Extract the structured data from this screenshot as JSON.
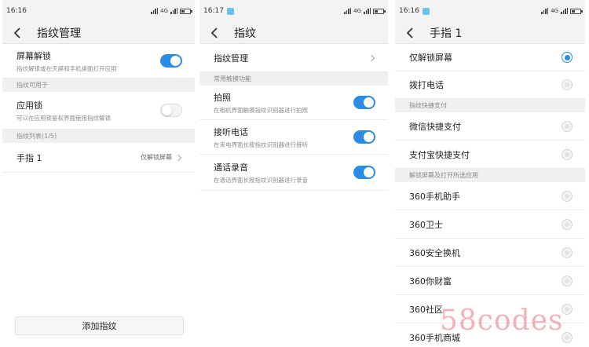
{
  "screen1": {
    "status_time": "16:16",
    "network": "4G",
    "title": "指纹管理",
    "unlock": {
      "label": "屏幕解锁",
      "sub": "指纹解锁或在灭屏和手机桌面打开应用",
      "on": true
    },
    "section_usable": "指纹可用于",
    "applock": {
      "label": "应用锁",
      "sub": "可以在应用锁鉴权界面使用指纹解锁",
      "on": false
    },
    "section_list": "指纹列表(1/5)",
    "finger": {
      "label": "手指 1",
      "value": "仅解锁屏幕"
    },
    "add_button": "添加指纹"
  },
  "screen2": {
    "status_time": "16:17",
    "network": "4G",
    "title": "指纹",
    "manage": "指纹管理",
    "section_touch": "常用触摸功能",
    "photo": {
      "label": "拍照",
      "sub": "在相机界面触摸指纹识别器进行拍照",
      "on": true
    },
    "answer": {
      "label": "接听电话",
      "sub": "在来电界面长按指纹识别器进行接听",
      "on": true
    },
    "record": {
      "label": "通话录音",
      "sub": "在通话界面长按指纹识别器进行录音",
      "on": true
    }
  },
  "screen3": {
    "status_time": "16:16",
    "network": "4G",
    "title": "手指 1",
    "items_top": [
      {
        "label": "仅解锁屏幕",
        "selected": true
      },
      {
        "label": "拨打电话",
        "selected": false
      }
    ],
    "section_pay": "指纹快捷支付",
    "items_pay": [
      {
        "label": "微信快捷支付",
        "selected": false
      },
      {
        "label": "支付宝快捷支付",
        "selected": false
      }
    ],
    "section_apps": "解锁屏幕及打开所选应用",
    "items_apps": [
      {
        "label": "360手机助手",
        "selected": false
      },
      {
        "label": "360卫士",
        "selected": false
      },
      {
        "label": "360安全换机",
        "selected": false
      },
      {
        "label": "360你财富",
        "selected": false
      },
      {
        "label": "360社区",
        "selected": false
      },
      {
        "label": "360手机商城",
        "selected": false
      }
    ]
  },
  "watermark": "58codes",
  "colors": {
    "accent": "#2a8de3",
    "statusbar": "#f3f3f3",
    "section": "#f0f0f0"
  }
}
